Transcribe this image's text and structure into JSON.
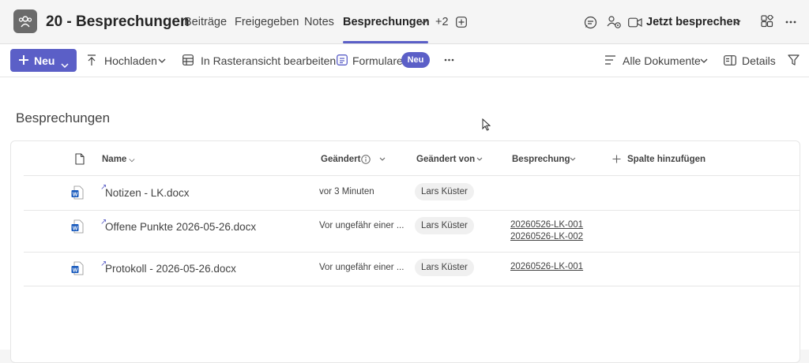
{
  "header": {
    "channel_title": "20 - Besprechungen",
    "tabs": [
      "Beiträge",
      "Freigegeben",
      "Notes",
      "Besprechungen"
    ],
    "more_tabs": "+2",
    "meet_button": "Jetzt besprechen",
    "accent": "#5b5fc7"
  },
  "toolbar": {
    "new_label": "Neu",
    "upload_label": "Hochladen",
    "grid_label": "In Rasteransicht bearbeiten",
    "forms_label": "Formulare",
    "forms_badge": "Neu",
    "view_label": "Alle Dokumente",
    "details_label": "Details"
  },
  "library": {
    "title": "Besprechungen",
    "columns": {
      "name": "Name",
      "modified": "Geändert",
      "modified_by": "Geändert von",
      "meeting": "Besprechung",
      "add_column": "Spalte hinzufügen"
    },
    "rows": [
      {
        "name": "Notizen - LK.docx",
        "modified": "vor 3 Minuten",
        "modified_by": "Lars Küster",
        "meetings": []
      },
      {
        "name": "Offene Punkte 2026-05-26.docx",
        "modified": "Vor ungefähr einer ...",
        "modified_by": "Lars Küster",
        "meetings": [
          "20260526-LK-001",
          "20260526-LK-002"
        ]
      },
      {
        "name": "Protokoll - 2026-05-26.docx",
        "modified": "Vor ungefähr einer ...",
        "modified_by": "Lars Küster",
        "meetings": [
          "20260526-LK-001"
        ]
      }
    ]
  }
}
